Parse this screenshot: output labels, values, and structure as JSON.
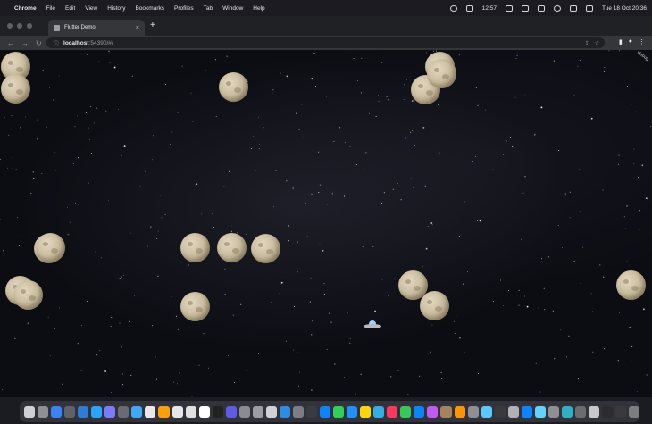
{
  "menubar": {
    "apple_icon": "apple-icon",
    "app_name": "Chrome",
    "menus": [
      "File",
      "Edit",
      "View",
      "History",
      "Bookmarks",
      "Profiles",
      "Tab",
      "Window",
      "Help"
    ],
    "clock_timer": "12:57",
    "datetime": "Tue 18 Oct  20:36"
  },
  "tab": {
    "title": "Flutter Demo",
    "close_label": "×"
  },
  "newtab_label": "+",
  "toolbar": {
    "url_host": "localhost",
    "url_rest": ":54390/#/"
  },
  "game": {
    "debug_text": "debug",
    "asteroids": [
      {
        "x": 0,
        "y": 0
      },
      {
        "x": 0,
        "y": 1
      },
      {
        "x": 1,
        "y": 2
      },
      {
        "x": 2,
        "y": 3
      },
      {
        "x": 3,
        "y": 4
      },
      {
        "x": 4,
        "y": 5
      },
      {
        "x": 5,
        "y": 6
      },
      {
        "x": 6,
        "y": 7
      },
      {
        "x": 7,
        "y": 8
      },
      {
        "x": 8,
        "y": 9
      },
      {
        "x": 9,
        "y": 10
      },
      {
        "x": 10,
        "y": 11
      },
      {
        "x": 11,
        "y": 12
      },
      {
        "x": 12,
        "y": 13
      },
      {
        "x": 13,
        "y": 14
      },
      {
        "x": 14,
        "y": 15
      },
      {
        "x": 15,
        "y": 16
      }
    ],
    "asteroid_count": 17,
    "ship_icon": "ufo-spaceship-icon"
  },
  "dock": {
    "icon_colors": [
      "#cfcfd4",
      "#8e8e95",
      "#3b82f6",
      "#5f6368",
      "#2f7bd8",
      "#2aa2ff",
      "#7b7bff",
      "#6a6a72",
      "#3fa9f5",
      "#e8e8ec",
      "#ff9f0a",
      "#e5e5ea",
      "#e0e0e0",
      "#ffffff",
      "#222222",
      "#5e5ce6",
      "#8b8b93",
      "#9c9ca4",
      "#d0d0d6",
      "#2e8be6",
      "#7d7d86",
      "#3a3a42",
      "#0a84ff",
      "#30d158",
      "#1e90ff",
      "#ffd60a",
      "#32ade6",
      "#ff375f",
      "#34c759",
      "#0a84ff",
      "#bf5af2",
      "#a2845e",
      "#ff9500",
      "#8e8e93",
      "#5ac8fa",
      "#3a3a3c",
      "#b0b0b5",
      "#0a84ff",
      "#64d2ff",
      "#8e8e93",
      "#30b0c7",
      "#6c6c70",
      "#c7c7cc",
      "#2c2c2e",
      "#3a3a3c",
      "#7d7d82"
    ]
  }
}
